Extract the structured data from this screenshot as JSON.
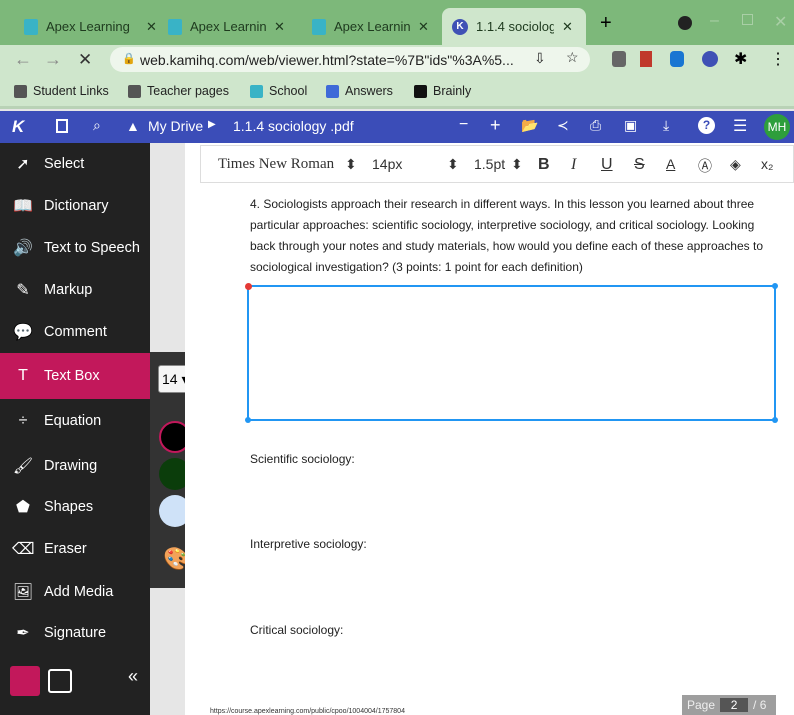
{
  "browser": {
    "tabs": [
      {
        "title": "Apex Learning"
      },
      {
        "title": "Apex Learning"
      },
      {
        "title": "Apex Learning"
      },
      {
        "title": "1.1.4 sociology .pdf",
        "active": true
      }
    ],
    "url": "web.kamihq.com/web/viewer.html?state=%7B\"ids\"%3A%5...",
    "bookmarks": [
      "Student Links",
      "Teacher pages",
      "School",
      "Answers",
      "Brainly"
    ]
  },
  "kami": {
    "breadcrumb_root": "My Drive",
    "file": "1.1.4 sociology .pdf",
    "avatar": "MH",
    "tools": [
      "Select",
      "Dictionary",
      "Text to Speech",
      "Markup",
      "Comment",
      "Text Box",
      "Equation",
      "Drawing",
      "Shapes",
      "Eraser",
      "Add Media",
      "Signature"
    ],
    "active_tool": "Text Box",
    "font_size_short": "14",
    "colors": [
      "#000000",
      "#0b3d0b",
      "#cfe2f8"
    ],
    "format": {
      "font": "Times New Roman",
      "size": "14px",
      "line": "1.5pt"
    }
  },
  "doc": {
    "question": "4. Sociologists approach their research in different ways. In this lesson you learned about three particular approaches: scientific sociology, interpretive sociology, and critical sociology. Looking back through your notes and study materials, how would you define each of these approaches to sociological investigation? (3 points: 1 point for each definition)",
    "labels": [
      "Scientific sociology:",
      "Interpretive sociology:",
      "Critical sociology:"
    ],
    "footer_url": "https://course.apexlearning.com/public/cpoo/1004004/1757804",
    "page_label": "Page",
    "page": "2",
    "page_total": "/ 6"
  }
}
